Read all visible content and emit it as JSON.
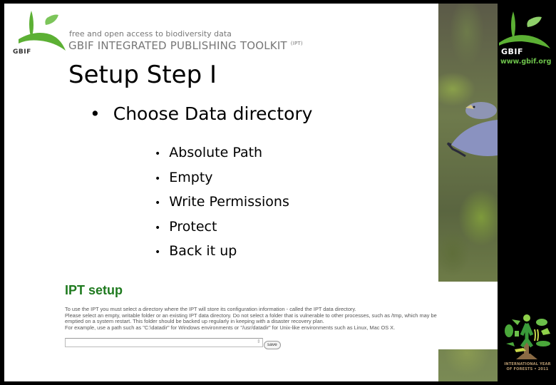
{
  "header": {
    "logo_label": "GBIF",
    "tagline": "free and open access to biodiversity data",
    "toolkit_title": "GBIF INTEGRATED PUBLISHING TOOLKIT",
    "toolkit_suffix": "(IPT)"
  },
  "slide": {
    "title": "Setup Step I",
    "bullet": "Choose Data directory",
    "sub_bullets": [
      "Absolute Path",
      "Empty",
      "Write Permissions",
      "Protect",
      "Back it up"
    ]
  },
  "ipt_setup": {
    "title": "IPT setup",
    "lines": [
      "To use the IPT you must select a directory where the IPT will store its configuration information - called the IPT data directory.",
      "Please select an empty, writable folder or an existing IPT data directory. Do not select a folder that is vulnerable to other processes, such as /tmp, which may be",
      "emptied on a system restart. This folder should be backed up regularly in keeping with a disaster recovery plan.",
      "For example, use a path such as \"C:\\datadir\" for Windows environments or \"/usr/datadir\" for Unix-like environments such as Linux, Mac OS X."
    ],
    "input_value": "",
    "save_label": "save"
  },
  "sidebar": {
    "logo_label": "GBIF",
    "url": "www.gbif.org",
    "iyf_line1": "INTERNATIONAL YEAR",
    "iyf_line2": "OF FORESTS • 2011"
  },
  "colors": {
    "gbif_green": "#5cb034",
    "ipt_title_green": "#1f7a1f",
    "url_green": "#6cc04a"
  }
}
